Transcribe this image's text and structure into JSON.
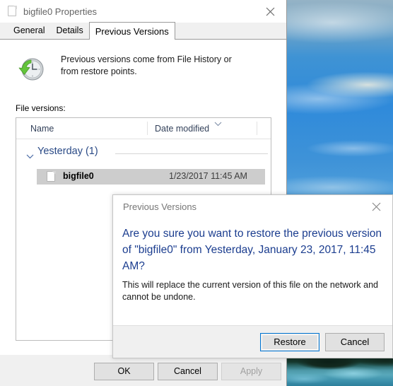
{
  "desktop": {
    "wallpaper_name": "sky-clouds-water-wallpaper",
    "sky_color": "#2f8ada",
    "water_color": "#2d7f9c"
  },
  "properties_window": {
    "title": "bigfile0 Properties",
    "title_icon": "file-icon",
    "close_icon": "close-icon",
    "tabs": [
      {
        "label": "General",
        "active": false
      },
      {
        "label": "Details",
        "active": false
      },
      {
        "label": "Previous Versions",
        "active": true
      }
    ],
    "info": {
      "icon": "clock-restore-icon",
      "text": "Previous versions come from File History or from restore points."
    },
    "file_versions_label": "File versions:",
    "list": {
      "columns": [
        {
          "label": "Name"
        },
        {
          "label": "Date modified",
          "sort_icon": "chevron-up-sort-icon"
        }
      ],
      "groups": [
        {
          "label": "Yesterday (1)",
          "expand_icon": "chevron-down-icon",
          "rows": [
            {
              "icon": "file-icon",
              "name": "bigfile0",
              "date_modified": "1/23/2017 11:45 AM",
              "selected": true
            }
          ]
        }
      ]
    },
    "buttons": {
      "ok": "OK",
      "cancel": "Cancel",
      "apply": "Apply",
      "apply_disabled": true
    }
  },
  "dialog": {
    "title": "Previous Versions",
    "close_icon": "close-icon",
    "main_text": "Are you sure you want to restore the previous version of \"bigfile0\" from Yesterday, January 23, 2017, 11:45 AM?",
    "sub_text": "This will replace the current version of this file on the network and cannot be undone.",
    "main_text_color": "#1b3d8f",
    "buttons": {
      "restore": "Restore",
      "cancel": "Cancel",
      "default": "Restore",
      "focus_color": "#0078d7"
    }
  }
}
